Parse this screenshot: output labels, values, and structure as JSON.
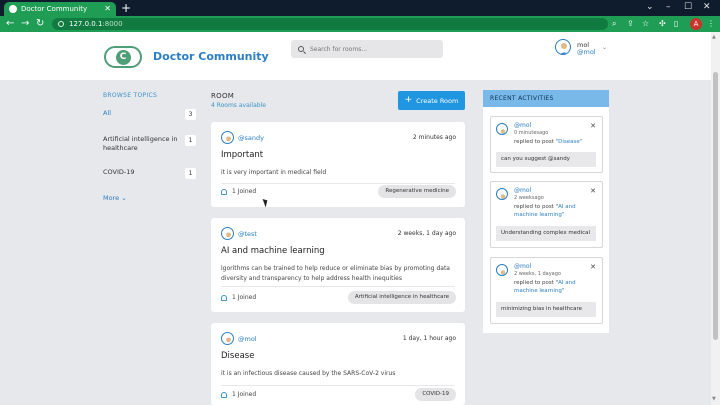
{
  "browser": {
    "tab_title": "Doctor Community",
    "url_host": "127.0.0.1",
    "url_port": ":8000",
    "profile_initial": "A"
  },
  "header": {
    "brand": "Doctor Community",
    "logo_letter": "C",
    "search_placeholder": "Search for rooms...",
    "user_name": "mol",
    "user_handle": "@mol"
  },
  "sidebar": {
    "heading": "BROWSE TOPICS",
    "topics": [
      {
        "label": "All",
        "count": "3"
      },
      {
        "label": "Artificial intelligence in healthcare",
        "count": "1"
      },
      {
        "label": "COVID-19",
        "count": "1"
      }
    ],
    "more_label": "More"
  },
  "main": {
    "title": "ROOM",
    "subtitle": "4 Rooms available",
    "create_label": "Create Room",
    "rooms": [
      {
        "author": "@sandy",
        "time": "2 minutes ago",
        "title": "Important",
        "body": "it is very important in medical field",
        "joined": "1 Joined",
        "tag": "Regenerative medicine"
      },
      {
        "author": "@test",
        "time": "2 weeks, 1 day ago",
        "title": "AI and machine learning",
        "body": "lgorithms can be trained to help reduce or eliminate bias by promoting data diversity and transparency to help address health inequities",
        "joined": "1 Joined",
        "tag": "Artificial intelligence in healthcare"
      },
      {
        "author": "@mol",
        "time": "1 day, 1 hour ago",
        "title": "Disease",
        "body": "it is an infectious disease caused by the SARS-CoV-2 virus",
        "joined": "1 Joined",
        "tag": "COVID-19"
      }
    ]
  },
  "activities": {
    "heading": "RECENT ACTIVITIES",
    "items": [
      {
        "user": "@mol",
        "time": "0 minutesago",
        "text": "replied to post ",
        "post": "\"Disease\"",
        "quote": "can you suggest @sandy"
      },
      {
        "user": "@mol",
        "time": "2 weeksago",
        "text": "replied to post \"",
        "post": "AI and machine learning\"",
        "quote": "Understanding complex medical"
      },
      {
        "user": "@mol",
        "time": "2 weeks, 1 dayago",
        "text": "replied to post \"",
        "post": "AI and machine learning\"",
        "quote": "minimizing bias in healthcare"
      }
    ]
  },
  "colors": {
    "brand_blue": "#2a7ec4",
    "browser_green": "#1f9d55",
    "create_button": "#2196e0",
    "activity_header": "#78b9ea"
  }
}
